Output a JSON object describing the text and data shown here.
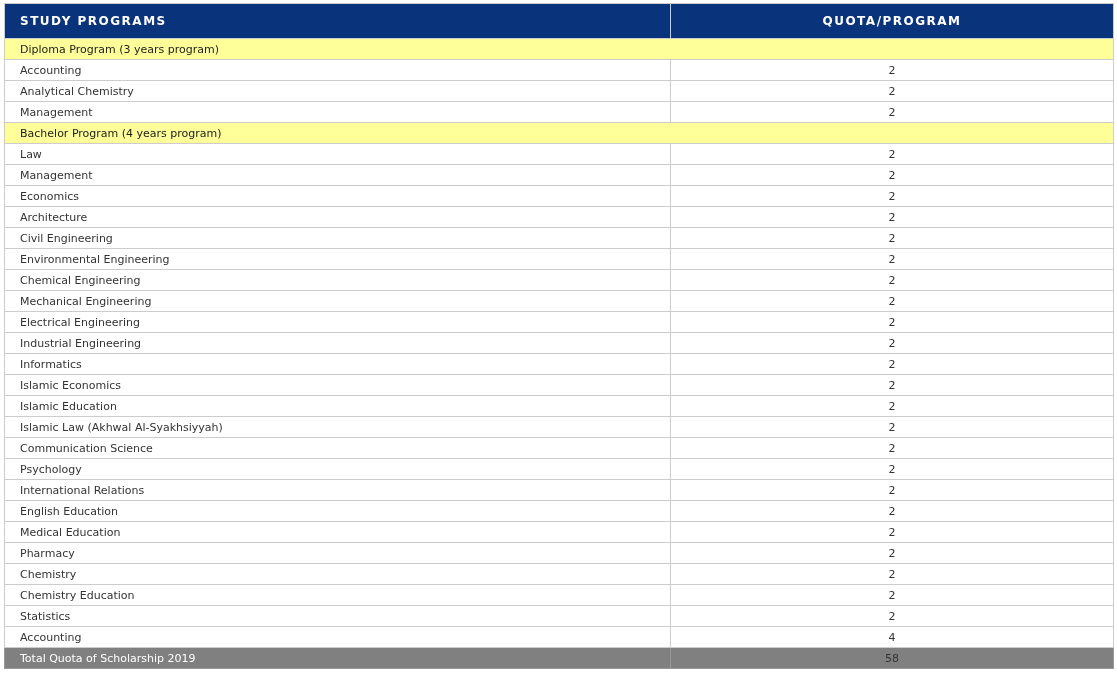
{
  "table": {
    "columns": [
      "STUDY PROGRAMS",
      "QUOTA/PROGRAM"
    ],
    "rows": [
      {
        "kind": "group",
        "program": "Diploma Program (3 years program)"
      },
      {
        "kind": "item",
        "program": "Accounting",
        "quota": "2"
      },
      {
        "kind": "item",
        "program": "Analytical Chemistry",
        "quota": "2"
      },
      {
        "kind": "item",
        "program": "Management",
        "quota": "2"
      },
      {
        "kind": "group",
        "program": "Bachelor Program (4 years program)"
      },
      {
        "kind": "item",
        "program": "Law",
        "quota": "2"
      },
      {
        "kind": "item",
        "program": "Management",
        "quota": "2"
      },
      {
        "kind": "item",
        "program": "Economics",
        "quota": "2"
      },
      {
        "kind": "item",
        "program": "Architecture",
        "quota": "2"
      },
      {
        "kind": "item",
        "program": "Civil Engineering",
        "quota": "2"
      },
      {
        "kind": "item",
        "program": "Environmental Engineering",
        "quota": "2"
      },
      {
        "kind": "item",
        "program": "Chemical Engineering",
        "quota": "2"
      },
      {
        "kind": "item",
        "program": "Mechanical Engineering",
        "quota": "2"
      },
      {
        "kind": "item",
        "program": "Electrical Engineering",
        "quota": "2"
      },
      {
        "kind": "item",
        "program": "Industrial Engineering",
        "quota": "2"
      },
      {
        "kind": "item",
        "program": "Informatics",
        "quota": "2"
      },
      {
        "kind": "item",
        "program": "Islamic Economics",
        "quota": "2"
      },
      {
        "kind": "item",
        "program": "Islamic Education",
        "quota": "2"
      },
      {
        "kind": "item",
        "program": "Islamic Law (Akhwal Al-Syakhsiyyah)",
        "quota": "2"
      },
      {
        "kind": "item",
        "program": "Communication Science",
        "quota": "2"
      },
      {
        "kind": "item",
        "program": "Psychology",
        "quota": "2"
      },
      {
        "kind": "item",
        "program": "International Relations",
        "quota": "2"
      },
      {
        "kind": "item",
        "program": "English Education",
        "quota": "2"
      },
      {
        "kind": "item",
        "program": "Medical Education",
        "quota": "2"
      },
      {
        "kind": "item",
        "program": "Pharmacy",
        "quota": "2"
      },
      {
        "kind": "item",
        "program": "Chemistry",
        "quota": "2"
      },
      {
        "kind": "item",
        "program": "Chemistry Education",
        "quota": "2"
      },
      {
        "kind": "item",
        "program": "Statistics",
        "quota": "2"
      },
      {
        "kind": "item",
        "program": "Accounting",
        "quota": "4"
      },
      {
        "kind": "total",
        "program": "Total Quota of Scholarship 2019",
        "quota": "58"
      }
    ]
  }
}
